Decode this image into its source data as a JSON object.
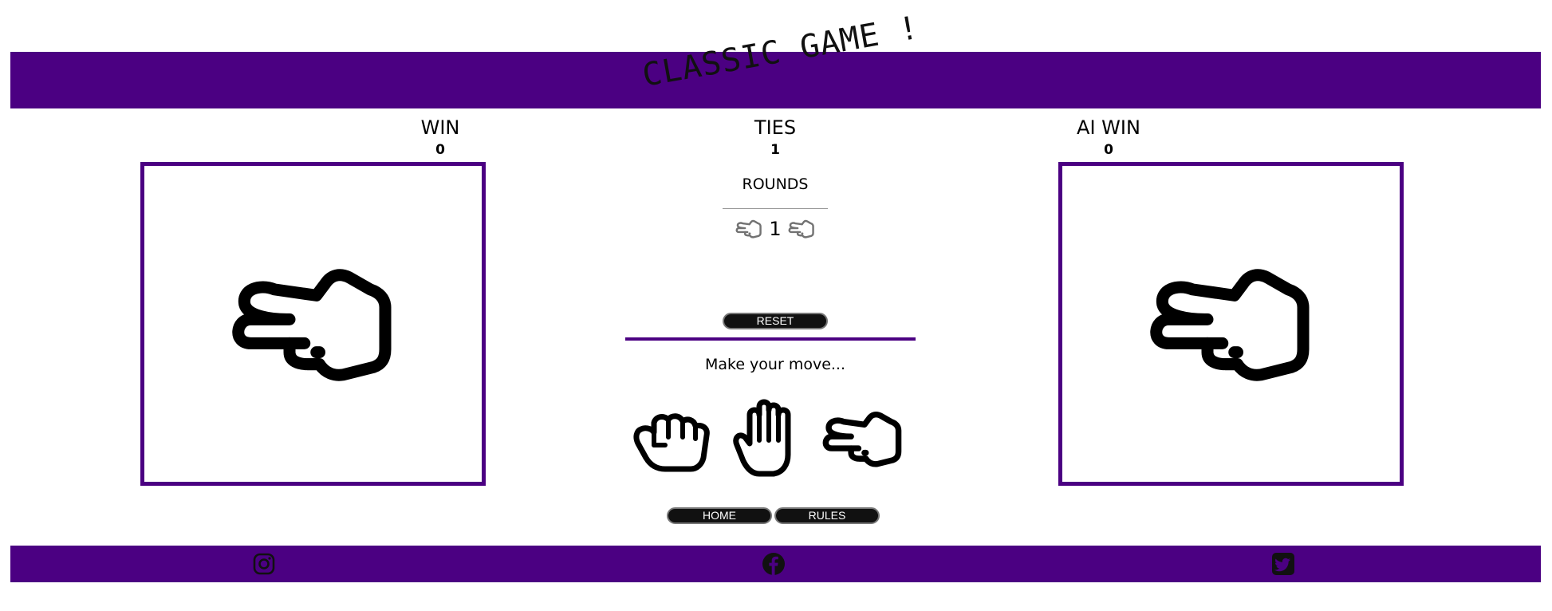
{
  "header": {
    "title": "CLASSIC GAME !",
    "color": "#4b0082"
  },
  "scoreboard": {
    "player_label": "WIN",
    "player_score": "0",
    "ties_label": "TIES",
    "ties_score": "1",
    "ai_label": "AI WIN",
    "ai_score": "0"
  },
  "player_choice": {
    "icon": "scissors-hand-icon"
  },
  "ai_choice": {
    "icon": "scissors-hand-icon"
  },
  "rounds": {
    "label": "ROUNDS",
    "value": "1",
    "icon": "scissors-hand-icon"
  },
  "controls": {
    "reset_label": "RESET",
    "prompt": "Make your move...",
    "moves": [
      {
        "icon": "rock-fist-icon"
      },
      {
        "icon": "paper-hand-icon"
      },
      {
        "icon": "scissors-hand-icon"
      }
    ],
    "home_label": "HOME",
    "rules_label": "RULES"
  },
  "footer": {
    "icons": [
      "instagram-icon",
      "facebook-icon",
      "twitter-icon"
    ]
  }
}
